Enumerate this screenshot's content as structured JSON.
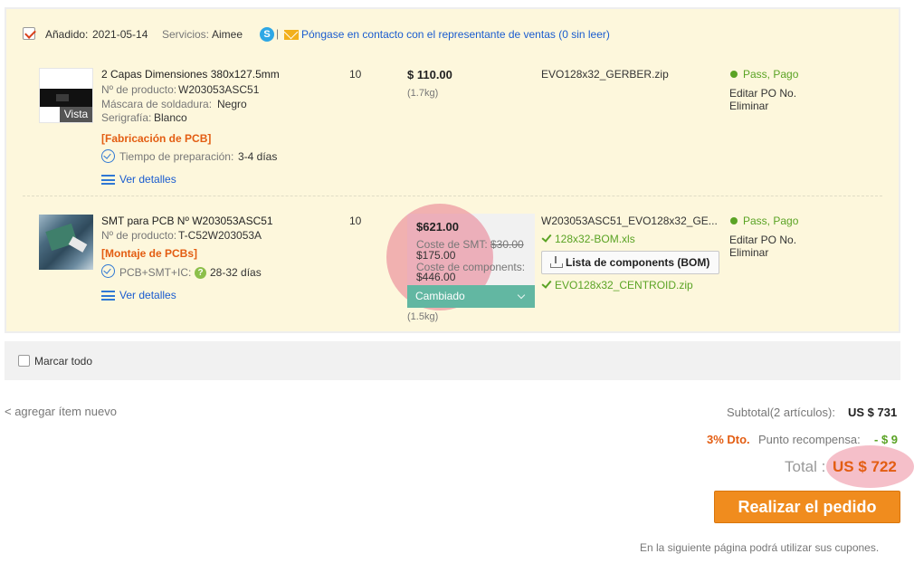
{
  "order": {
    "added_label": "Añadido:",
    "added_date": "2021-05-14",
    "services_label": "Servicios:",
    "services_name": "Aimee",
    "skype_glyph": "S",
    "separator": "|",
    "contact_link": "Póngase en contacto con el representante de ventas (0 sin leer)",
    "items": [
      {
        "title": "2 Capas Dimensiones 380x127.5mm",
        "product_label": "Nº de producto:",
        "product_no": "W203053ASC51",
        "mask_label": "Máscara de soldadura:",
        "mask_value": "Negro",
        "silk_label": "Serigrafía:",
        "silk_value": "Blanco",
        "category": "[Fabricación de PCB]",
        "prep_label": "Tiempo de preparación:",
        "prep_value": "3-4 días",
        "details_link": "Ver detalles",
        "view_label": "Vista",
        "qty": "10",
        "price": "$ 110.00",
        "weight": "(1.7kg)",
        "file": "EVO128x32_GERBER.zip",
        "status": "Pass, Pago",
        "edit_po": "Editar PO No.",
        "delete": "Eliminar"
      },
      {
        "title": "SMT para PCB Nº W203053ASC51",
        "product_label": "Nº de producto:",
        "product_no": "T-C52W203053A",
        "category": "[Montaje de PCBs]",
        "prep_label": "PCB+SMT+IC:",
        "prep_help": "?",
        "prep_value": "28-32 días",
        "details_link": "Ver detalles",
        "qty": "10",
        "price": "$621.00",
        "smt_cost_label": "Coste de SMT:",
        "smt_cost_old": "$30.00",
        "smt_cost_value": "$175.00",
        "components_cost_label": "Coste de components:",
        "components_cost_value": "$446.00",
        "changed_label": "Cambiado",
        "weight": "(1.5kg)",
        "file": "W203053ASC51_EVO128x32_GE...",
        "bom_file": "128x32-BOM.xls",
        "bom_button": "Lista de components (BOM)",
        "centroid_file": "EVO128x32_CENTROID.zip",
        "status": "Pass, Pago",
        "edit_po": "Editar PO No.",
        "delete": "Eliminar"
      }
    ]
  },
  "select_all": "Marcar todo",
  "add_new_item": "< agregar ítem nuevo",
  "summary": {
    "subtotal_label": "Subtotal(2 artículos):",
    "subtotal_value": "US $ 731",
    "discount_label": "3% Dto.",
    "reward_label": "Punto recompensa:",
    "reward_value": "- $ 9",
    "total_label": "Total :",
    "total_value": "US $ 722",
    "place_order": "Realizar el pedido",
    "coupon_note": "En la siguiente página podrá utilizar sus cupones."
  },
  "colors": {
    "order_bg": "#fdf7dc",
    "accent_orange": "#e35d12",
    "link_blue": "#1a5ccf",
    "status_green": "#5aa324",
    "button_orange": "#f08c1e",
    "changed_teal": "#62b7a2"
  },
  "icons": [
    "checkbox-checked-icon",
    "skype-icon",
    "mail-icon",
    "clock-icon",
    "list-icon",
    "help-icon",
    "download-icon",
    "check-icon",
    "chevron-down-icon"
  ]
}
